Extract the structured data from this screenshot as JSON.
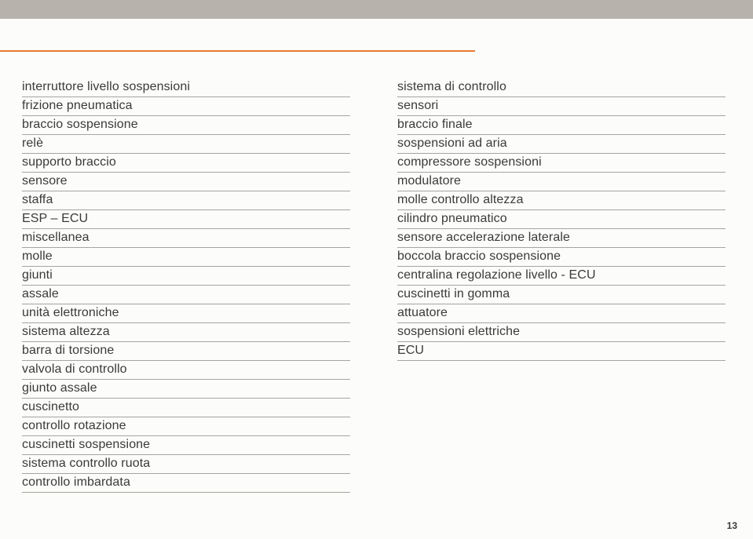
{
  "left_column": [
    "interruttore livello sospensioni",
    "frizione pneumatica",
    "braccio sospensione",
    "relè",
    "supporto braccio",
    "sensore",
    "staffa",
    "ESP – ECU",
    "miscellanea",
    "molle",
    "giunti",
    "assale",
    "unità elettroniche",
    "sistema altezza",
    "barra di torsione",
    "valvola di controllo",
    "giunto assale",
    "cuscinetto",
    "controllo rotazione",
    "cuscinetti sospensione",
    "sistema controllo ruota",
    "controllo imbardata"
  ],
  "right_column": [
    "sistema di controllo",
    "sensori",
    "braccio finale",
    "sospensioni ad aria",
    "compressore sospensioni",
    "modulatore",
    "molle controllo altezza",
    "cilindro pneumatico",
    "sensore accelerazione laterale",
    "boccola braccio sospensione",
    "centralina regolazione livello - ECU",
    "cuscinetti in gomma",
    "attuatore",
    "sospensioni elettriche",
    "ECU"
  ],
  "page_number": "13"
}
